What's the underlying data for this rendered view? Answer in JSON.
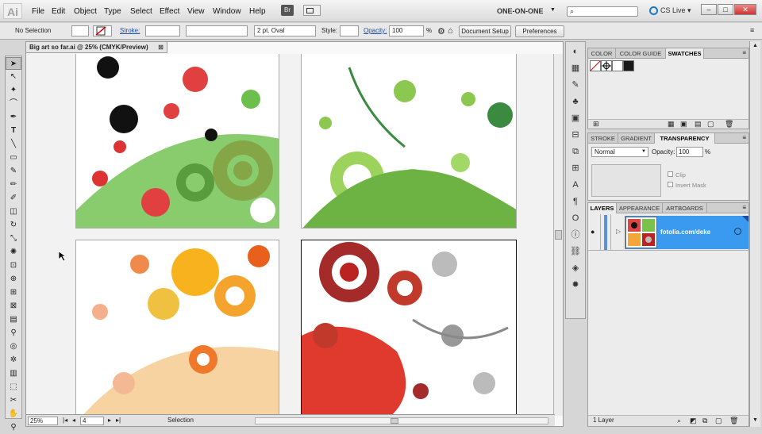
{
  "app": {
    "logo": "Ai",
    "menus": [
      "File",
      "Edit",
      "Object",
      "Type",
      "Select",
      "Effect",
      "View",
      "Window",
      "Help"
    ],
    "bridge_label": "Br",
    "workspace": "ONE-ON-ONE",
    "cs_live": "CS Live",
    "win_controls": [
      "–",
      "□",
      "✕"
    ]
  },
  "control_bar": {
    "selection": "No Selection",
    "stroke_label": "Stroke:",
    "brush": "2 pt. Oval",
    "style_label": "Style:",
    "opacity_label": "Opacity:",
    "opacity_value": "100",
    "percent": "%",
    "document_setup": "Document Setup",
    "preferences": "Preferences"
  },
  "document": {
    "tab_title": "Big art so far.ai @ 25% (CMYK/Preview)",
    "tab_close": "⊠"
  },
  "status_bar": {
    "zoom": "25%",
    "page": "4",
    "tool": "Selection"
  },
  "panels": {
    "color_tabs": [
      "COLOR",
      "COLOR GUIDE",
      "SWATCHES"
    ],
    "stroke_tabs": [
      "STROKE",
      "GRADIENT",
      "TRANSPARENCY"
    ],
    "blend_mode": "Normal",
    "opacity_label": "Opacity:",
    "opacity_value": "100",
    "percent": "%",
    "clip_label": "Clip",
    "invert_mask_label": "Invert Mask",
    "layers_tabs": [
      "LAYERS",
      "APPEARANCE",
      "ARTBOARDS"
    ],
    "layer_name": "fotolia.com/deke",
    "layer_count": "1 Layer"
  },
  "colors": {
    "layer_highlight": "#3a9af0",
    "accent_link": "#1a4ea8"
  }
}
